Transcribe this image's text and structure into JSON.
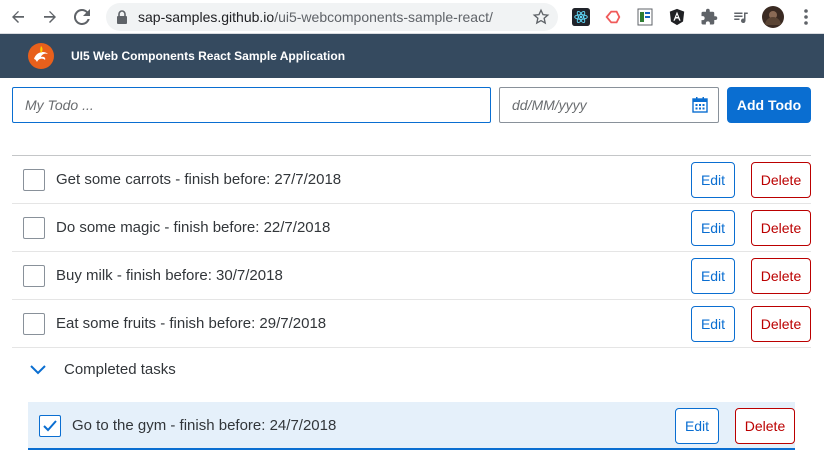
{
  "browser": {
    "url_domain": "sap-samples.github.io",
    "url_path": "/ui5-webcomponents-sample-react/",
    "icons": [
      "back-arrow-icon",
      "forward-arrow-icon",
      "reload-icon",
      "lock-icon",
      "star-icon",
      "extensions-icon",
      "menu-icon"
    ]
  },
  "app": {
    "title": "UI5 Web Components React Sample Application",
    "brand_color": "#354a5f",
    "accent_color": "#0a6ed1",
    "negative_color": "#bb0000"
  },
  "form": {
    "todo_placeholder": "My Todo ...",
    "date_placeholder": "dd/MM/yyyy",
    "add_label": "Add Todo"
  },
  "todos": [
    {
      "text": "Get some carrots - finish before: 27/7/2018",
      "done": false
    },
    {
      "text": "Do some magic - finish before: 22/7/2018",
      "done": false
    },
    {
      "text": "Buy milk - finish before: 30/7/2018",
      "done": false
    },
    {
      "text": "Eat some fruits - finish before: 29/7/2018",
      "done": false
    }
  ],
  "completed_panel": {
    "title": "Completed tasks",
    "expanded": true,
    "items": [
      {
        "text": "Go to the gym - finish before: 24/7/2018",
        "done": true
      }
    ]
  },
  "labels": {
    "edit": "Edit",
    "delete": "Delete"
  }
}
